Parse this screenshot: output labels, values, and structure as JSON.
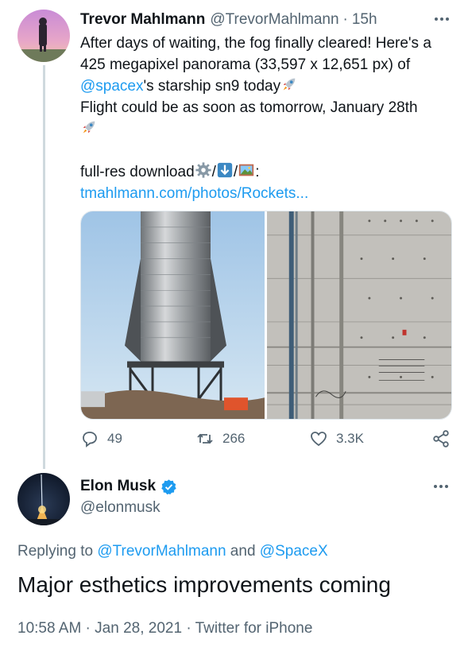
{
  "tweet1": {
    "display_name": "Trevor Mahlmann",
    "handle": "@TrevorMahlmann",
    "separator": "·",
    "time": "15h",
    "text": {
      "line1": "After days of waiting, the fog finally cleared! Here's a",
      "line2": "425 megapixel panorama (33,597 x 12,651 px) of",
      "mention": "@spacex",
      "line3_rest": "'s starship sn9 today",
      "line4": "Flight could be as soon as tomorrow, January 28th",
      "line5_prefix": "full-res download",
      "slash": "/",
      "colon": ":",
      "link": "tmahlmann.com/photos/Rockets..."
    },
    "emojis": [
      "rocket-emoji",
      "gear-emoji",
      "down-arrow-emoji",
      "framed-picture-emoji"
    ],
    "stats": {
      "replies": "49",
      "retweets": "266",
      "likes": "3.3K"
    },
    "images": [
      "starship-sn9-panorama-left",
      "starship-sn9-hull-closeup"
    ]
  },
  "tweet2": {
    "display_name": "Elon Musk",
    "handle": "@elonmusk",
    "verified": true,
    "replying_prefix": "Replying to ",
    "replying_user1": "@TrevorMahlmann",
    "replying_and": " and ",
    "replying_user2": "@SpaceX",
    "text": "Major esthetics improvements coming",
    "time": "10:58 AM",
    "date": "Jan 28, 2021",
    "dot": " · ",
    "source": "Twitter for iPhone"
  },
  "colors": {
    "link": "#1d9bf0",
    "text": "#0f1419",
    "secondary": "#536471",
    "thread_line": "#cfd9de"
  }
}
